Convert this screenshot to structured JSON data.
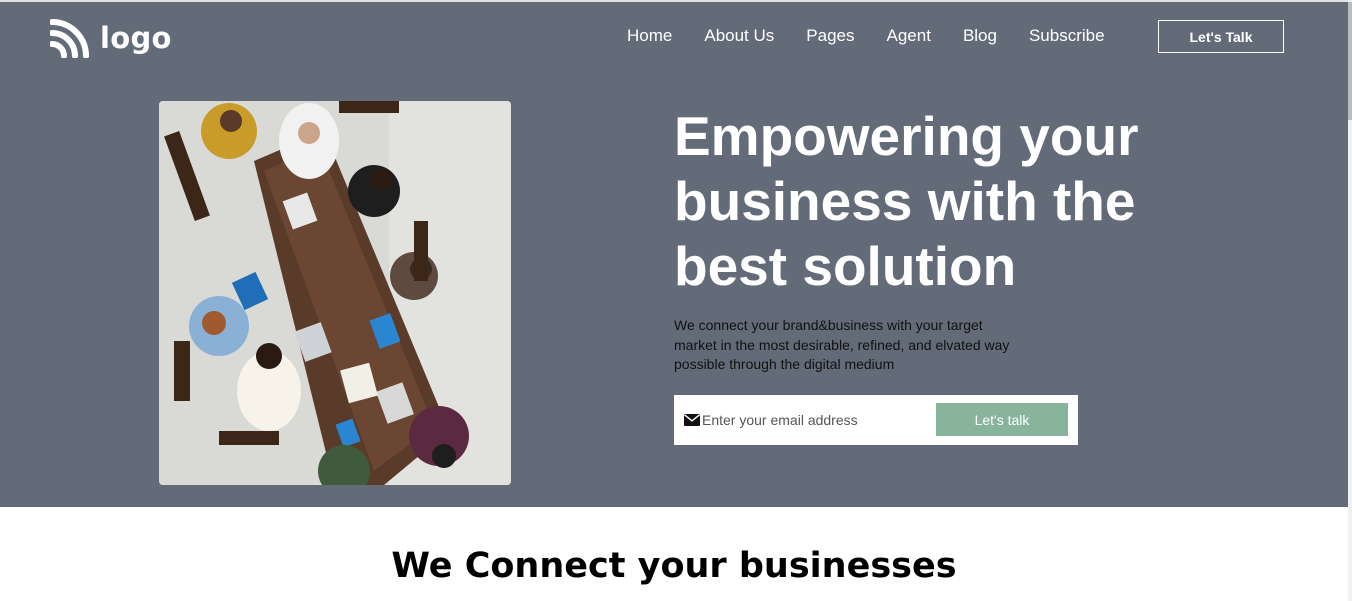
{
  "header": {
    "logo_text": "logo",
    "nav_items": [
      "Home",
      "About Us",
      "Pages",
      "Agent",
      "Blog",
      "Subscribe"
    ],
    "cta_label": "Let's Talk"
  },
  "hero": {
    "image_icon": "team-meeting-photo",
    "headline_lines": [
      "Empowering your",
      "business with the",
      "best solution"
    ],
    "subtext_lines": [
      "We connect your brand&business with your target",
      "market in the most desirable, refined, and elvated way",
      "possible through the digital medium"
    ],
    "email_placeholder": "Enter your email address",
    "email_icon": "mail-icon",
    "submit_label": "Let's talk"
  },
  "section": {
    "title": "We Connect your businesses"
  },
  "colors": {
    "hero_bg": "#636b79",
    "accent_green": "#89b49c",
    "text_white": "#ffffff"
  }
}
